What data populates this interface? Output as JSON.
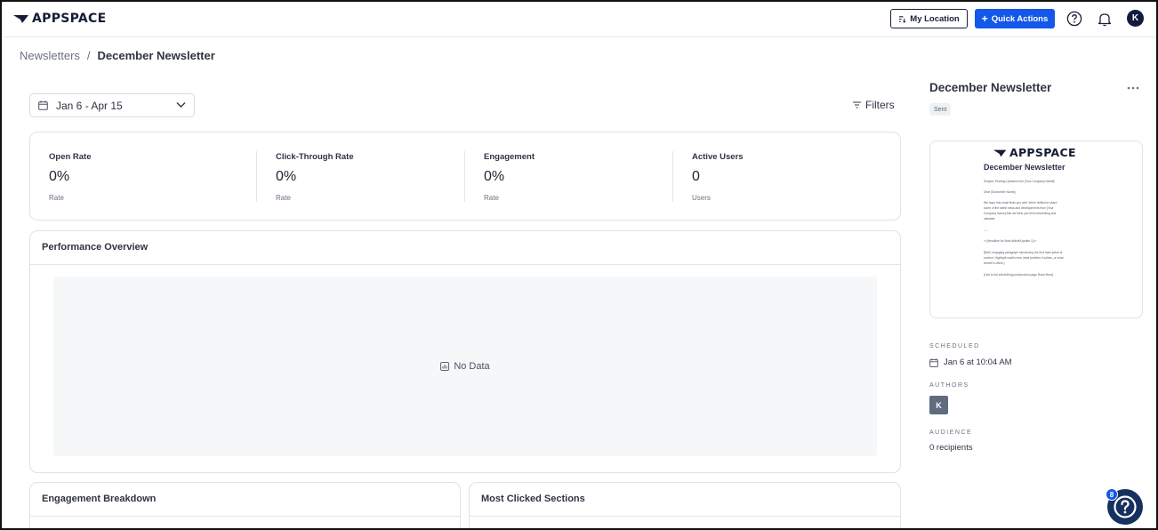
{
  "header": {
    "logo_text": "APPSPACE",
    "my_location_label": "My Location",
    "quick_actions_label": "Quick Actions",
    "avatar_initial": "K",
    "icons": [
      "location-icon",
      "plus-icon",
      "help-circle-icon",
      "bell-icon"
    ]
  },
  "breadcrumb": {
    "parent": "Newsletters",
    "separator": "/",
    "current": "December Newsletter"
  },
  "toolbar": {
    "date_range": "Jan 6 - Apr 15",
    "filters_label": "Filters"
  },
  "stats": [
    {
      "label": "Open Rate",
      "value": "0%",
      "unit": "Rate"
    },
    {
      "label": "Click-Through Rate",
      "value": "0%",
      "unit": "Rate"
    },
    {
      "label": "Engagement",
      "value": "0%",
      "unit": "Rate"
    },
    {
      "label": "Active Users",
      "value": "0",
      "unit": "Users"
    }
  ],
  "performance": {
    "title": "Performance Overview",
    "empty_text": "No Data"
  },
  "engagement_breakdown": {
    "title": "Engagement Breakdown"
  },
  "most_clicked": {
    "title": "Most Clicked Sections"
  },
  "side_panel": {
    "title": "December Newsletter",
    "status": "Sent",
    "preview": {
      "logo_text": "APPSPACE",
      "title": "December Newsletter",
      "lines": [
        "Subject: Exciting Updates from [Your Company Name]!",
        "Dear [Subscriber Name],",
        "We hope this email finds you well. We're thrilled to share",
        "some of the latest news and developments from [Your",
        "Company Name] that we think you'll find interesting and",
        "valuable.",
        "----",
        "<<[Headline for Main Article/Update 1]>>",
        "[Brief, engaging paragraph introducing the first main piece of",
        "content. Highlight what's new, what problem it solves, or what",
        "benefit it offers.]",
        "[Link to full article/blog post/product page Read More]"
      ]
    },
    "scheduled_label": "SCHEDULED",
    "scheduled_value": "Jan 6 at 10:04 AM",
    "authors_label": "AUTHORS",
    "author_initial": "K",
    "audience_label": "AUDIENCE",
    "audience_value": "0 recipients"
  },
  "help": {
    "count": "8"
  },
  "colors": {
    "accent": "#1358e8",
    "navy": "#121a3e",
    "panel_bg": "#f6f7f9",
    "border": "#dfe2e6"
  }
}
